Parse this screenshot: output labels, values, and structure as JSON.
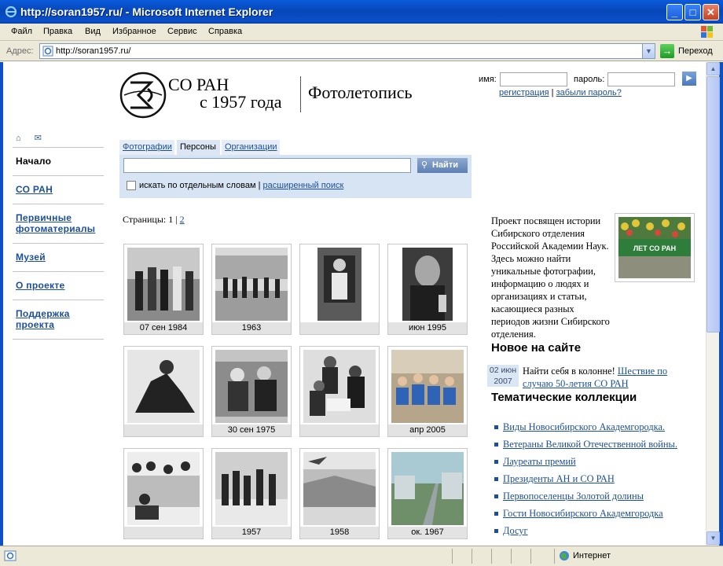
{
  "window": {
    "title": "http://soran1957.ru/ - Microsoft Internet Explorer",
    "menu": [
      "Файл",
      "Правка",
      "Вид",
      "Избранное",
      "Сервис",
      "Справка"
    ],
    "address_label": "Адрес:",
    "url": "http://soran1957.ru/",
    "go_label": "Переход",
    "status_zone": "Интернет"
  },
  "header": {
    "logo_line1": "СО РАН",
    "logo_line2": "с 1957 года",
    "logo_line3": "Фотолетопись",
    "login_label": "имя:",
    "password_label": "пароль:",
    "register_link": "регистрация",
    "forgot_link": "забыли пароль?"
  },
  "sidebar": {
    "items": [
      {
        "label": "Начало",
        "current": true
      },
      {
        "label": "СО РАН"
      },
      {
        "label": "Первичные фотоматериалы"
      },
      {
        "label": "Музей"
      },
      {
        "label": "О проекте"
      },
      {
        "label": "Поддержка проекта"
      }
    ]
  },
  "search": {
    "tabs": [
      "Фотографии",
      "Персоны",
      "Организации"
    ],
    "active_tab": "Персоны",
    "value": "",
    "button": "Найти",
    "option_label": "искать по отдельным словам",
    "advanced_link": "расширенный поиск"
  },
  "pagination": {
    "label": "Страницы:",
    "current": "1",
    "separator": "|",
    "other": "2"
  },
  "gallery": [
    {
      "date": "07 сен 1984"
    },
    {
      "date": "1963"
    },
    {
      "date": ""
    },
    {
      "date": "июн 1995"
    },
    {
      "date": ""
    },
    {
      "date": "30 сен 1975"
    },
    {
      "date": ""
    },
    {
      "date": "апр 2005"
    },
    {
      "date": ""
    },
    {
      "date": "1957"
    },
    {
      "date": "1958"
    },
    {
      "date": "ок. 1967"
    }
  ],
  "intro": {
    "text": "Проект посвящен истории Сибирского отделения Российской Академии Наук. Здесь можно найти уникальные фотографии, информацию о людях и организациях и статьи, касающиеся разных периодов жизни Сибирского отделения.",
    "photo_banner": "ЛЕТ СО РАН"
  },
  "news": {
    "heading": "Новое на сайте",
    "date_day": "02 июн",
    "date_year": "2007",
    "text": "Найти себя в колонне!",
    "link": "Шествие по случаю 50-летия СО РАН"
  },
  "collections": {
    "heading": "Тематические коллекции",
    "items": [
      "Виды Новосибирского Академгородка.",
      "Ветераны Великой Отечественной войны.",
      "Лауреаты премий",
      "Президенты АН и СО РАН",
      "Первопоселенцы Золотой долины",
      "Гости Новосибирского Академгородка",
      "Досуг"
    ]
  }
}
